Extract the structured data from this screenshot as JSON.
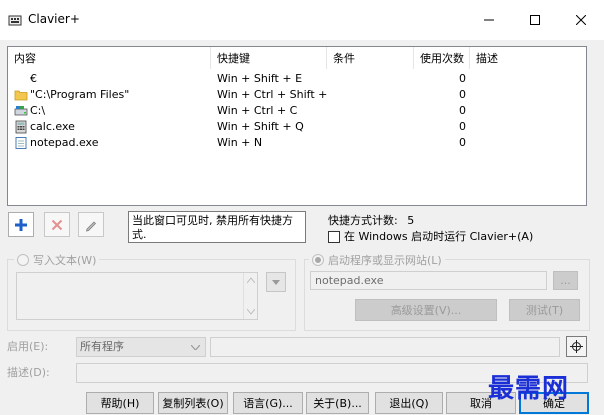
{
  "window": {
    "title": "Clavier+"
  },
  "list": {
    "headers": [
      "内容",
      "快捷键",
      "条件",
      "使用次数",
      "描述"
    ],
    "rows": [
      {
        "content": "€",
        "shortcut": "Win + Shift + E",
        "count": "0",
        "icon": "none"
      },
      {
        "content": "\"C:\\Program Files\"",
        "shortcut": "Win + Ctrl + Shift + P",
        "count": "0",
        "icon": "folder-icon"
      },
      {
        "content": "C:\\",
        "shortcut": "Win + Ctrl + C",
        "count": "0",
        "icon": "drive-icon"
      },
      {
        "content": "calc.exe",
        "shortcut": "Win + Shift + Q",
        "count": "0",
        "icon": "calculator-icon"
      },
      {
        "content": "notepad.exe",
        "shortcut": "Win + N",
        "count": "0",
        "icon": "notepad-icon"
      }
    ]
  },
  "toolbar": {
    "info_text": "当此窗口可见时, 禁用所有快捷方式.",
    "count_label": "快捷方式计数:",
    "count_value": "5",
    "startup_label": "在 Windows 启动时运行 Clavier+(A)"
  },
  "write_text": {
    "label": "写入文本(W)"
  },
  "launch": {
    "label": "启动程序或显示网站(L)",
    "value": "notepad.exe",
    "browse_label": "...",
    "advanced_label": "高级设置(V)...",
    "test_label": "测试(T)"
  },
  "enable": {
    "label": "启用(E):",
    "program_value": "所有程序"
  },
  "description": {
    "label": "描述(D):"
  },
  "buttons": {
    "help": "帮助(H)",
    "copy_list": "复制列表(O)",
    "language": "语言(G)...",
    "about": "关于(B)...",
    "exit": "退出(Q)",
    "cancel": "取消",
    "ok": "确定"
  },
  "watermark": "最需网",
  "colors": {
    "accent": "#0078d7",
    "add": "#1e5fc8",
    "delete": "#d04040",
    "watermark": "#1a2fd6"
  }
}
